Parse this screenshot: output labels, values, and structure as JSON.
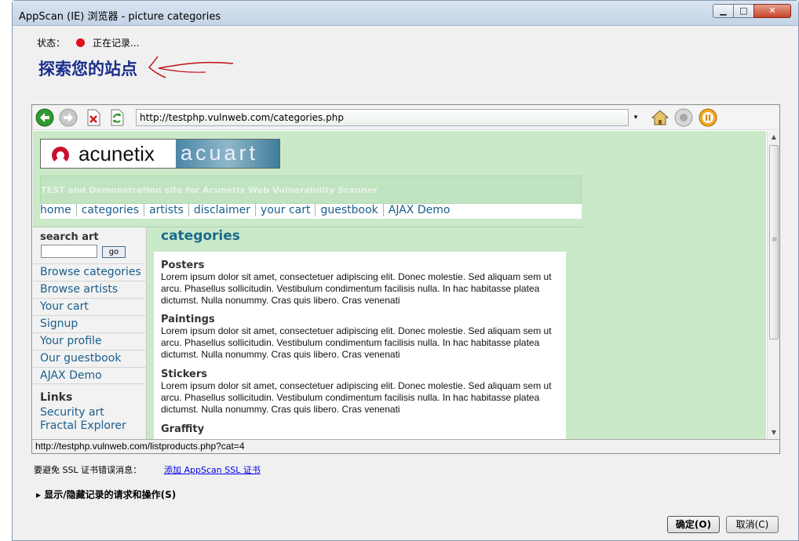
{
  "window": {
    "title": "AppScan (IE) 浏览器 - picture categories",
    "min_glyph": "▁",
    "max_glyph": "□",
    "close_glyph": "✕"
  },
  "status": {
    "label": "状态：",
    "text": "正在记录..."
  },
  "heading": "探索您的站点",
  "toolbar": {
    "back_icon": "back-arrow-icon",
    "forward_icon": "forward-arrow-icon",
    "stop_icon": "stop-icon",
    "refresh_icon": "refresh-icon",
    "url": "http://testphp.vulnweb.com/categories.php",
    "home_icon": "home-icon",
    "record_stop_icon": "record-stop-icon",
    "pause_icon": "pause-icon"
  },
  "site": {
    "logo_left": "acunetix",
    "logo_right": "acuart",
    "tagline": "TEST and Demonstration site for Acunetix Web Vulnerability Scanner",
    "nav": [
      "home",
      "categories",
      "artists",
      "disclaimer",
      "your cart",
      "guestbook",
      "AJAX Demo"
    ],
    "search_title": "search art",
    "go_label": "go",
    "sidebar": [
      "Browse categories",
      "Browse artists",
      "Your cart",
      "Signup",
      "Your profile",
      "Our guestbook",
      "AJAX Demo"
    ],
    "links_title": "Links",
    "links": [
      "Security art",
      "Fractal Explorer"
    ],
    "content_title": "categories",
    "categories": [
      {
        "title": "Posters",
        "desc": "Lorem ipsum dolor sit amet, consectetuer adipiscing elit. Donec molestie. Sed aliquam sem ut arcu. Phasellus sollicitudin. Vestibulum condimentum facilisis nulla. In hac habitasse platea dictumst. Nulla nonummy. Cras quis libero. Cras venenati"
      },
      {
        "title": "Paintings",
        "desc": "Lorem ipsum dolor sit amet, consectetuer adipiscing elit. Donec molestie. Sed aliquam sem ut arcu. Phasellus sollicitudin. Vestibulum condimentum facilisis nulla. In hac habitasse platea dictumst. Nulla nonummy. Cras quis libero. Cras venenati"
      },
      {
        "title": "Stickers",
        "desc": "Lorem ipsum dolor sit amet, consectetuer adipiscing elit. Donec molestie. Sed aliquam sem ut arcu. Phasellus sollicitudin. Vestibulum condimentum facilisis nulla. In hac habitasse platea dictumst. Nulla nonummy. Cras quis libero. Cras venenati"
      },
      {
        "title": "Graffity"
      }
    ]
  },
  "browser_status": "http://testphp.vulnweb.com/listproducts.php?cat=4",
  "ssl": {
    "text": "要避免 SSL 证书错误消息：",
    "link": "添加 AppScan SSL 证书"
  },
  "toggle": "▸ 显示/隐藏记录的请求和操作(S)",
  "buttons": {
    "ok": "确定(O)",
    "cancel": "取消(C)"
  },
  "colors": {
    "record_dot": "#e0101c",
    "heading": "#1a2e8c",
    "link": "#1a5e8c",
    "page_bg": "#c9e9c9"
  }
}
